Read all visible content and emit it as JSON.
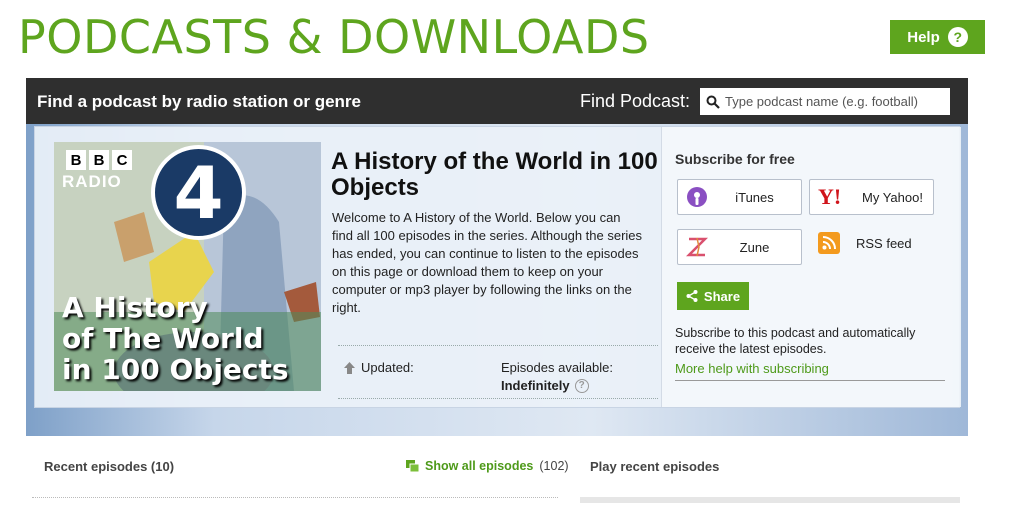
{
  "page": {
    "title": "PODCASTS & DOWNLOADS",
    "help_label": "Help"
  },
  "finder": {
    "title": "Find a podcast by radio station or genre",
    "label": "Find Podcast:",
    "placeholder": "Type podcast name (e.g. football)"
  },
  "artwork": {
    "logo_letters": [
      "B",
      "B",
      "C"
    ],
    "station": "RADIO",
    "number": "4",
    "title_lines": [
      "A History",
      "of The World",
      "in 100 Objects"
    ]
  },
  "series": {
    "title": "A History of the World in 100 Objects",
    "description": "Welcome to A History of the World. Below you can find all 100 episodes in the series. Although the series has ended, you can continue to listen to the episodes on this page or download them to keep on your computer or mp3 player by following the links on the right.",
    "updated_label": "Updated:",
    "availability_label": "Episodes available:",
    "availability_value": "Indefinitely"
  },
  "subscribe": {
    "title": "Subscribe for free",
    "itunes": "iTunes",
    "yahoo": "My Yahoo!",
    "zune": "Zune",
    "rss": "RSS feed",
    "share": "Share",
    "note": "Subscribe to this podcast and automatically receive the latest episodes.",
    "help_link": "More help with subscribing"
  },
  "episodes": {
    "recent_label": "Recent episodes (10)",
    "show_all_label": "Show all episodes",
    "show_all_count": "(102)",
    "play_recent_label": "Play recent episodes"
  },
  "colors": {
    "brand_green": "#5ea51e",
    "bar_dark": "#2f2f2f",
    "rss_orange": "#f39a1e"
  }
}
